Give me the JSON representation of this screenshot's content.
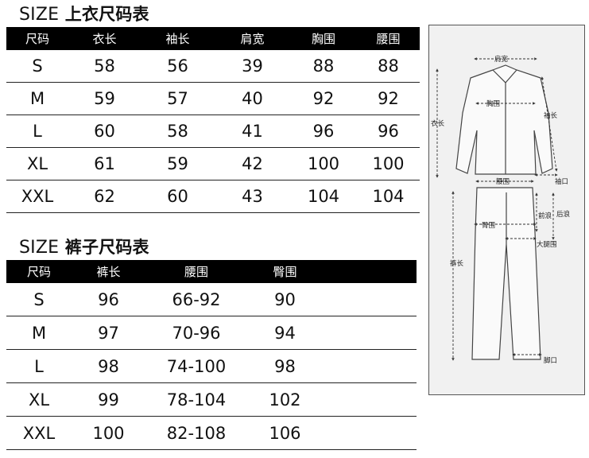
{
  "top_section": {
    "title_en": "SIZE",
    "title_zh": "上衣尺码表",
    "headers": [
      "尺码",
      "衣长",
      "袖长",
      "肩宽",
      "胸围",
      "腰围"
    ],
    "rows": [
      [
        "S",
        "58",
        "56",
        "39",
        "88",
        "88"
      ],
      [
        "M",
        "59",
        "57",
        "40",
        "92",
        "92"
      ],
      [
        "L",
        "60",
        "58",
        "41",
        "96",
        "96"
      ],
      [
        "XL",
        "61",
        "59",
        "42",
        "100",
        "100"
      ],
      [
        "XXL",
        "62",
        "60",
        "43",
        "104",
        "104"
      ]
    ]
  },
  "bottom_section": {
    "title_en": "SIZE",
    "title_zh": "裤子尺码表",
    "headers": [
      "尺码",
      "裤长",
      "腰围",
      "臀围"
    ],
    "rows": [
      [
        "S",
        "96",
        "66-92",
        "90"
      ],
      [
        "M",
        "97",
        "70-96",
        "94"
      ],
      [
        "L",
        "98",
        "74-100",
        "98"
      ],
      [
        "XL",
        "99",
        "78-104",
        "102"
      ],
      [
        "XXL",
        "100",
        "82-108",
        "106"
      ]
    ]
  },
  "diagram": {
    "labels": {
      "shoulder": "肩宽",
      "chest": "胸围",
      "sleeve": "袖长",
      "length": "衣长",
      "cuff": "袖口",
      "waist": "腰围",
      "front_rise": "前浪",
      "back_rise": "后浪",
      "hip": "臀围",
      "thigh": "大腿围",
      "pants_length": "裤长",
      "leg_opening": "脚口"
    }
  }
}
